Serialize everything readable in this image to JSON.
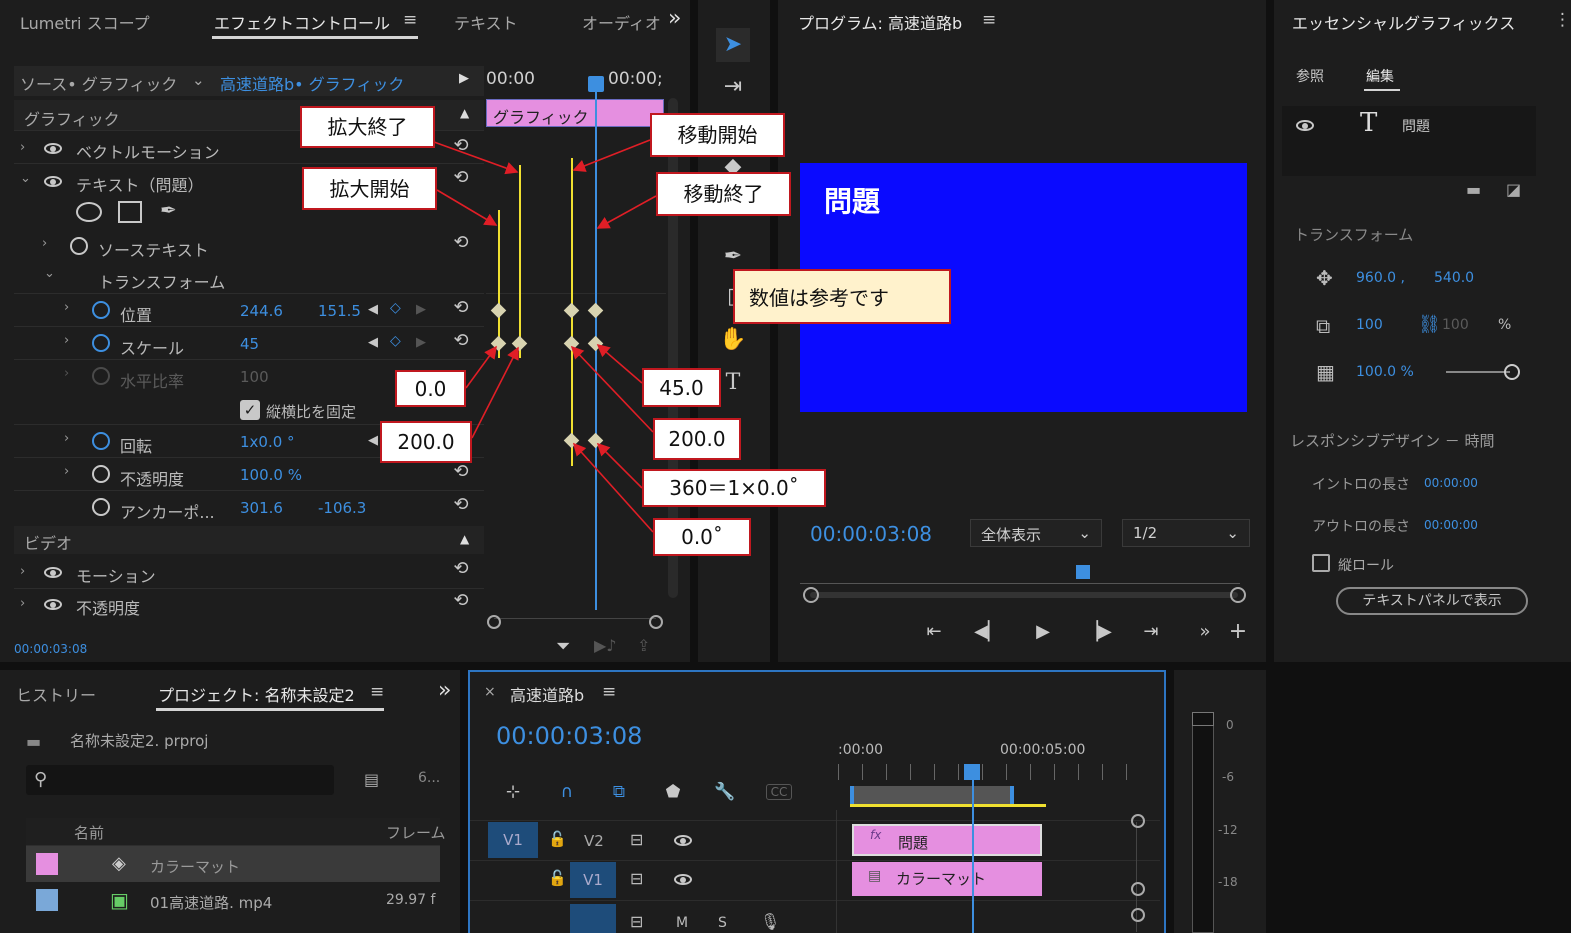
{
  "effect_controls": {
    "tabs": [
      "Lumetri スコープ",
      "エフェクトコントロール",
      "テキスト",
      "オーディオ"
    ],
    "overflow": "»",
    "source": "ソース• グラフィック",
    "clip_selector": "高速道路b• グラフィック",
    "timeline_start": "00:00",
    "timeline_end": "00:00;",
    "graphic_clip_label": "グラフィック",
    "section_graphic": "グラフィック",
    "vector_motion": "ベクトルモーション",
    "text_layer": "テキスト（問題）",
    "source_text": "ソーステキスト",
    "transform": "トランスフォーム",
    "position_label": "位置",
    "position_x": "244.6",
    "position_y": "151.5",
    "scale_label": "スケール",
    "scale_value": "45",
    "hscale_label": "水平比率",
    "hscale_value": "100",
    "uniform_label": "縦横比を固定",
    "rotation_label": "回転",
    "rotation_value": "1x0.0 °",
    "opacity_label": "不透明度",
    "opacity_value": "100.0 %",
    "anchor_label": "アンカーポ...",
    "anchor_x": "301.6",
    "anchor_y": "-106.3",
    "section_video": "ビデオ",
    "motion": "モーション",
    "opacity2": "不透明度",
    "timecode": "00:00:03:08"
  },
  "callouts": {
    "zoom_end": "拡大終了",
    "zoom_start": "拡大開始",
    "move_start": "移動開始",
    "move_end": "移動終了",
    "val_00": "0.0",
    "val_450": "45.0",
    "val_200a": "200.0",
    "val_200b": "200.0",
    "val_360": "360＝1×0.0˚",
    "val_0deg": "0.0˚",
    "note": "数値は参考です"
  },
  "program": {
    "title": "プログラム: 高速道路b",
    "overlay_text": "問題",
    "timecode": "00:00:03:08",
    "fit": "全体表示",
    "resolution": "1/2",
    "screen_color": "#0a0aff"
  },
  "essential": {
    "title": "エッセンシャルグラフィックス",
    "tab_browse": "参照",
    "tab_edit": "編集",
    "layer_name": "問題",
    "transform": "トランスフォーム",
    "pos_x": "960.0 ,",
    "pos_y": "540.0",
    "scale": "100",
    "scale2": "100",
    "pct": "%",
    "opacity": "100.0 %",
    "responsive": "レスポンシブデザイン － 時間",
    "intro": "イントロの長さ",
    "intro_val": "00:00:00",
    "outro": "アウトロの長さ",
    "outro_val": "00:00:00",
    "roll": "縦ロール",
    "show_text_panel": "テキストパネルで表示"
  },
  "project": {
    "tabs": [
      "ヒストリー",
      "プロジェクト: 名称未設定2"
    ],
    "file": "名称未設定2. prproj",
    "count": "6...",
    "col_name": "名前",
    "col_frame": "フレーム",
    "items": [
      {
        "name": "カラーマット",
        "fps": "",
        "color": "#e58fe0"
      },
      {
        "name": "01高速道路. mp4",
        "fps": "29.97 f",
        "color": "#7aa8d8"
      }
    ]
  },
  "timeline": {
    "title": "高速道路b",
    "timecode": "00:00:03:08",
    "ruler_start": ":00:00",
    "ruler_mid": "00:00:05:00",
    "v2": "V2",
    "v1": "V1",
    "v1_src": "V1",
    "clip_graphic": "問題",
    "clip_matte": "カラーマット",
    "audio_m": "M",
    "audio_s": "S",
    "meter": [
      "0",
      "-6",
      "-12",
      "-18"
    ]
  }
}
